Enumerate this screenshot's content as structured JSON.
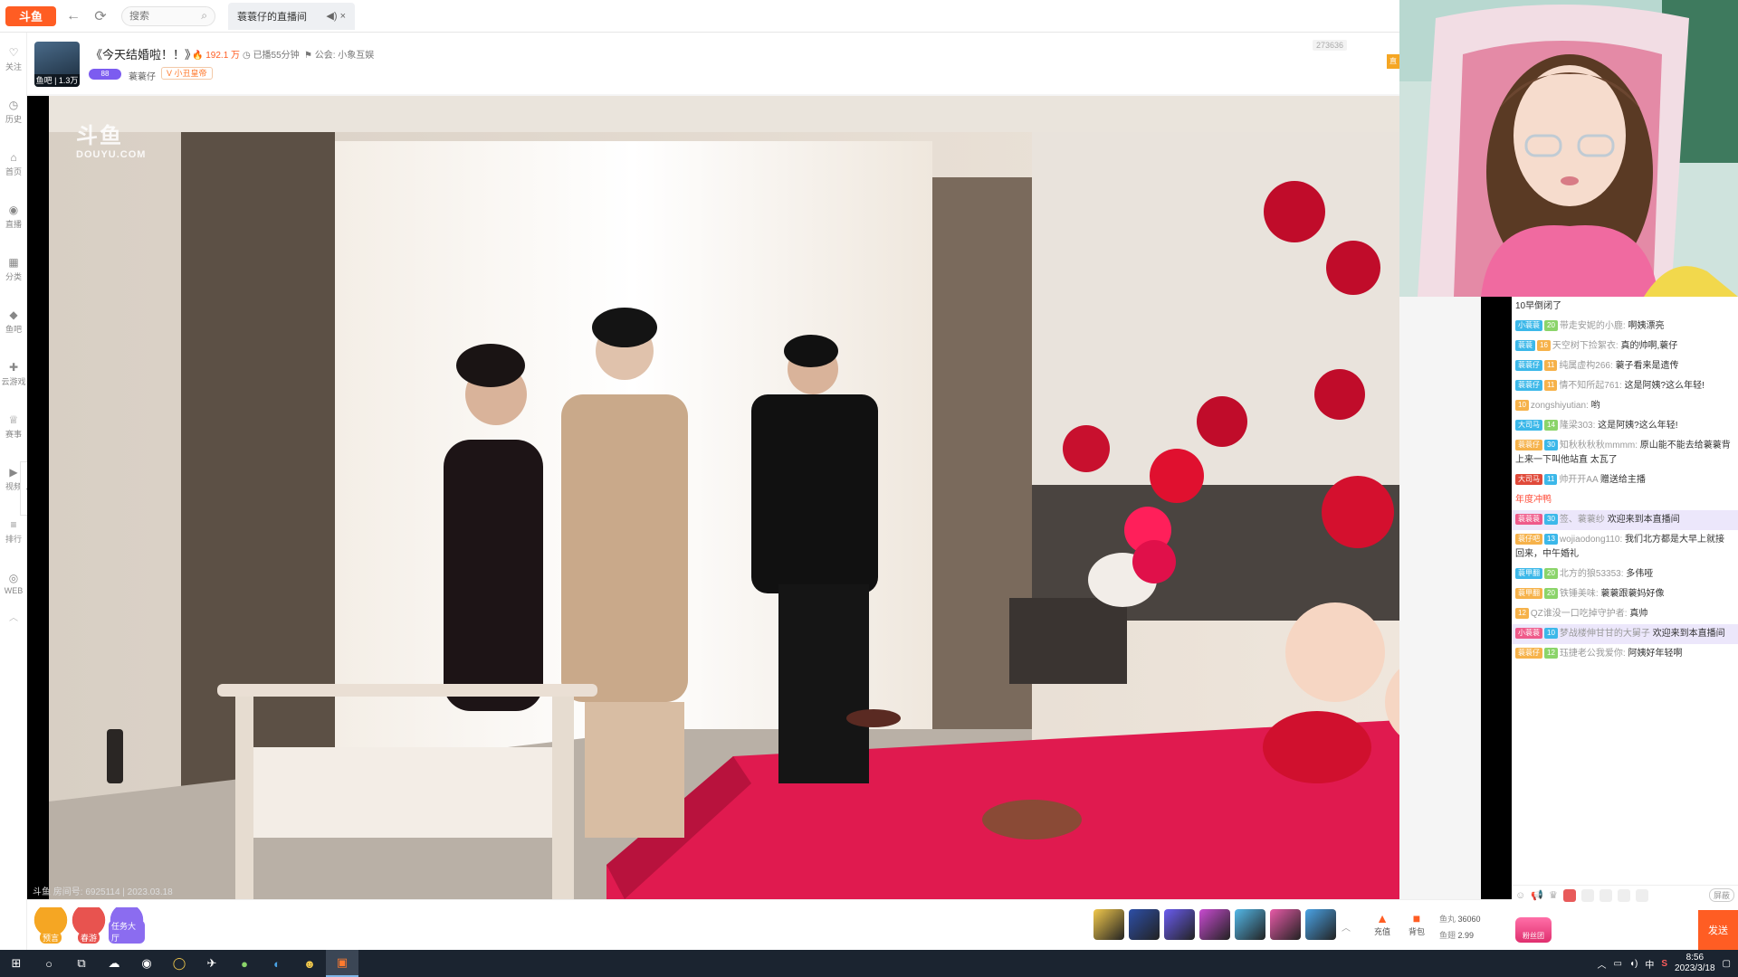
{
  "browser": {
    "logo_text": "斗鱼",
    "search_placeholder": "搜索",
    "tab_title": "蓑蓑仔的直播间",
    "tab_icons": "◀) ×"
  },
  "sidebar": {
    "items": [
      {
        "label": "关注",
        "icon": "heart-icon"
      },
      {
        "label": "历史",
        "icon": "clock-icon"
      },
      {
        "label": "首页",
        "icon": "home-icon"
      },
      {
        "label": "直播",
        "icon": "live-icon"
      },
      {
        "label": "分类",
        "icon": "grid-icon"
      },
      {
        "label": "鱼吧",
        "icon": "fishbar-icon"
      },
      {
        "label": "云游戏",
        "icon": "gamepad-icon"
      },
      {
        "label": "赛事",
        "icon": "trophy-icon"
      },
      {
        "label": "视频",
        "icon": "video-icon"
      },
      {
        "label": "排行",
        "icon": "rank-icon"
      },
      {
        "label": "WEB",
        "icon": "web-icon"
      }
    ]
  },
  "room": {
    "title": "《今天结婚啦！！》",
    "hot": "192.1 万",
    "started": "已播55分钟",
    "guild": "公会: 小象互娱",
    "avatar_caption": "鱼吧 | 1.3万",
    "level": "88",
    "anchor_name": "蓑蓑仔",
    "tag": "小丑皇帝",
    "viewer_id": "273636",
    "side_tag": "直"
  },
  "video": {
    "watermark_top": "斗鱼",
    "watermark_bottom": "DOUYU.COM",
    "room_info": "斗鱼 房间号: 6925114 | 2023.03.18"
  },
  "chat": {
    "messages": [
      {
        "badges": [],
        "user": "",
        "text": "10早倒闭了",
        "hl": false
      },
      {
        "badges": [
          [
            "小蓑蓑",
            "b-fan"
          ],
          [
            "20",
            "b-green"
          ]
        ],
        "user": "带走安妮的小鹿:",
        "text": "啊姨漂亮",
        "hl": false
      },
      {
        "badges": [
          [
            "蓑蓑",
            "b-fan"
          ],
          [
            "16",
            "b-lv"
          ]
        ],
        "user": "天空树下捡絮衣:",
        "text": "真的帅啊,蓑仔",
        "hl": false
      },
      {
        "badges": [
          [
            "蓑蓑仔",
            "b-fan"
          ],
          [
            "11",
            "b-lv"
          ]
        ],
        "user": "纯属虚构266:",
        "text": "蓑子看来是遗传",
        "hl": false
      },
      {
        "badges": [
          [
            "蓑蓑仔",
            "b-fan"
          ],
          [
            "11",
            "b-lv"
          ]
        ],
        "user": "情不知所起761:",
        "text": "这是阿姨?这么年轻!",
        "hl": false
      },
      {
        "badges": [
          [
            "10",
            "b-lv"
          ]
        ],
        "user": "zongshiyutian:",
        "text": "哟",
        "hl": false
      },
      {
        "badges": [
          [
            "大司马",
            "b-fan"
          ],
          [
            "14",
            "b-green"
          ]
        ],
        "user": "隆梁303:",
        "text": "这是阿姨?这么年轻!",
        "hl": false
      },
      {
        "badges": [
          [
            "蓑蓑仔",
            "b-lv"
          ],
          [
            "30",
            "b-fan"
          ]
        ],
        "user": "知秋秋秋秋mmmm:",
        "text": "原山能不能去给蓑蓑背上来一下叫他站直 太瓦了",
        "hl": false
      },
      {
        "badges": [
          [
            "大司马",
            "b-red"
          ],
          [
            "11",
            "b-fan"
          ]
        ],
        "user": "帅开开AA",
        "text": "赠送给主播",
        "hl": false
      },
      {
        "badges": [],
        "user": "",
        "text": "年度冲鸭",
        "hl": false,
        "sys": true
      },
      {
        "badges": [
          [
            "蓑蓑蓑",
            "b-pink"
          ],
          [
            "30",
            "b-fan"
          ]
        ],
        "user": "签、蓑蓑纱",
        "text": "欢迎来到本直播间",
        "hl": true
      },
      {
        "badges": [
          [
            "蓑仔吧",
            "b-lv"
          ],
          [
            "13",
            "b-fan"
          ]
        ],
        "user": "wojiaodong110:",
        "text": "我们北方都是大早上就接回来，中午婚礼",
        "hl": false
      },
      {
        "badges": [
          [
            "蓑甲翻",
            "b-fan"
          ],
          [
            "20",
            "b-green"
          ]
        ],
        "user": "北方的狼53353:",
        "text": "多伟哑",
        "hl": false
      },
      {
        "badges": [
          [
            "蓑甲翻",
            "b-lv"
          ],
          [
            "20",
            "b-green"
          ]
        ],
        "user": "铁锤美味:",
        "text": "蓑蓑跟蓑妈好像",
        "hl": false
      },
      {
        "badges": [
          [
            "12",
            "b-lv"
          ]
        ],
        "user": "QZ谁没一口吃掉守护者:",
        "text": "真帅",
        "hl": false
      },
      {
        "badges": [
          [
            "小蓑蓑",
            "b-pink"
          ],
          [
            "10",
            "b-fan"
          ]
        ],
        "user": "梦战楼伸甘甘的大舅子",
        "text": "欢迎来到本直播间",
        "hl": true
      },
      {
        "badges": [
          [
            "蓑蓑仔",
            "b-lv"
          ],
          [
            "12",
            "b-green"
          ]
        ],
        "user": "珏捷老公我爱你:",
        "text": "阿姨好年轻啊",
        "hl": false
      }
    ],
    "input_placeholder": "",
    "send_label": "发送",
    "shield_label": "屏蔽",
    "fan_ticket": "粉丝团"
  },
  "giftbar": {
    "left_actions": [
      {
        "label": "预言",
        "color": "#f5a623"
      },
      {
        "label": "春游",
        "color": "#e8534f"
      },
      {
        "label": "任务大厅",
        "color": "#8b6cf0"
      }
    ],
    "gifts": [
      "#f2c94c",
      "#2d4fa8",
      "#6a5cf0",
      "#c94bd1",
      "#53b8e8",
      "#e85aa8",
      "#4aa3e6"
    ],
    "utils": [
      {
        "label": "充值",
        "icon": "▲"
      },
      {
        "label": "背包",
        "icon": "■"
      }
    ],
    "wallet": {
      "yuwan_label": "鱼丸",
      "yuwan": "36060",
      "yuchi_label": "鱼翅",
      "yuchi": "2.99"
    }
  },
  "taskbar": {
    "time": "8:56",
    "date": "2023/3/18",
    "ime": "中",
    "s_label": "S"
  }
}
